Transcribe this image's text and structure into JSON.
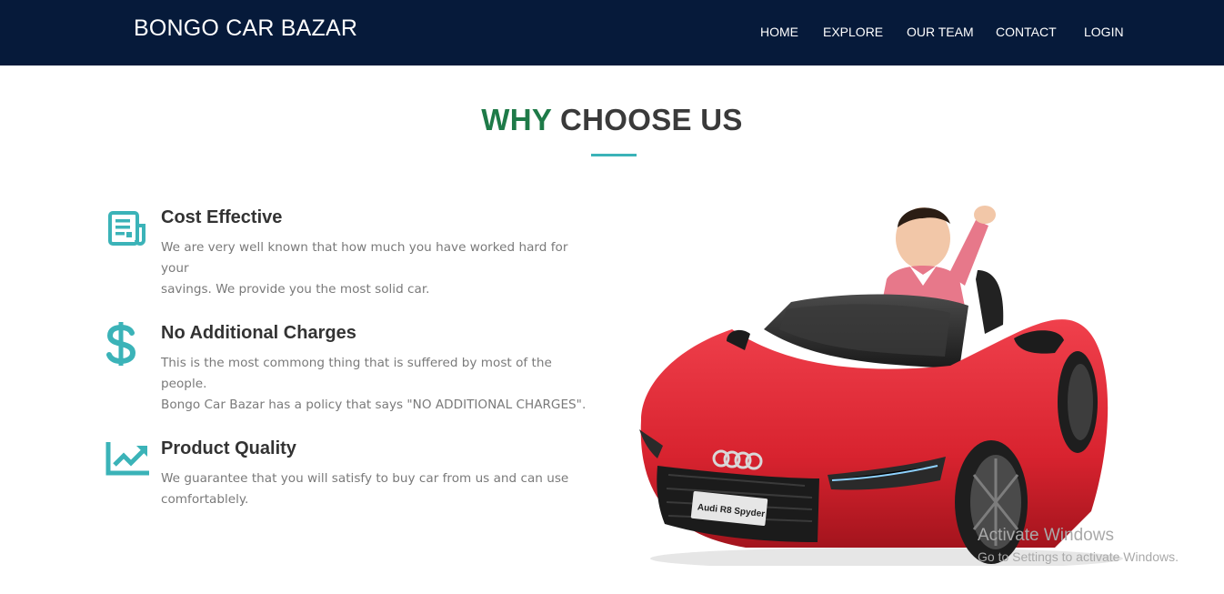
{
  "header": {
    "brand": "BONGO CAR BAZAR",
    "nav": [
      "HOME",
      "EXPLORE",
      "OUR TEAM",
      "CONTACT",
      "LOGIN"
    ]
  },
  "section": {
    "title_highlight": "WHY",
    "title_rest": "CHOOSE US"
  },
  "features": [
    {
      "icon": "newspaper-icon",
      "title": "Cost Effective",
      "text_line1": "We are very well known that how much you have worked hard for your",
      "text_line2": "savings. We provide you the most solid car."
    },
    {
      "icon": "dollar-icon",
      "title": "No Additional Charges",
      "text_line1": "This is the most commong thing that is suffered by most of the people.",
      "text_line2": "Bongo Car Bazar has a policy that says \"NO ADDITIONAL CHARGES\"."
    },
    {
      "icon": "trending-chart-icon",
      "title": "Product Quality",
      "text_line1": "We guarantee that you will satisfy to buy car from us and can use",
      "text_line2": "comfortablely."
    }
  ],
  "image": {
    "plate_text": "Audi R8 Spyder"
  },
  "watermark": {
    "title": "Activate Windows",
    "subtitle": "Go to Settings to activate Windows."
  },
  "colors": {
    "navbar": "#061a3a",
    "accent_teal": "#3bb3b8",
    "title_green": "#1e7a48",
    "car_red": "#d8232f"
  }
}
